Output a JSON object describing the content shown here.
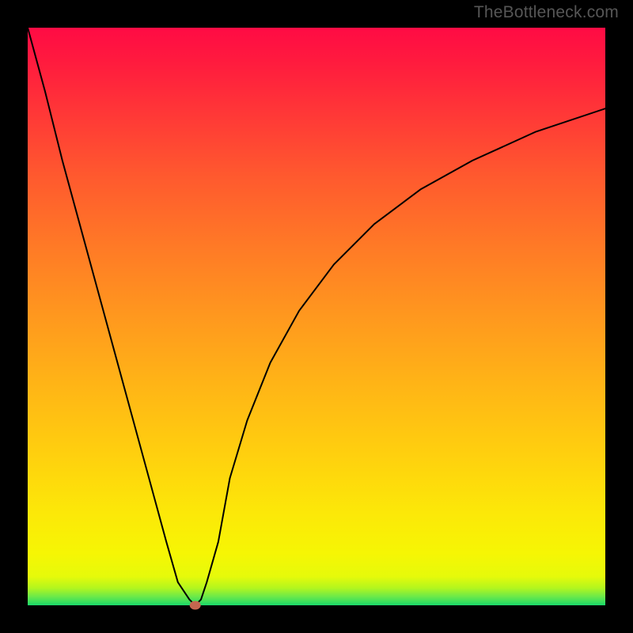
{
  "watermark": "TheBottleneck.com",
  "chart_data": {
    "type": "line",
    "title": "",
    "xlabel": "",
    "ylabel": "",
    "xlim": [
      0,
      100
    ],
    "ylim": [
      0,
      100
    ],
    "grid": false,
    "legend": false,
    "series": [
      {
        "name": "bottleneck-curve",
        "x": [
          0,
          3,
          6,
          9,
          12,
          15,
          18,
          21,
          24,
          26,
          28,
          29,
          30,
          31,
          33,
          35,
          38,
          42,
          47,
          53,
          60,
          68,
          77,
          88,
          100
        ],
        "y": [
          100,
          89,
          77,
          66,
          55,
          44,
          33,
          22,
          11,
          4,
          1,
          0,
          1,
          4,
          11,
          22,
          32,
          42,
          51,
          59,
          66,
          72,
          77,
          82,
          86
        ]
      }
    ],
    "marker": {
      "x": 29,
      "y": 0,
      "color": "#c4664f"
    }
  },
  "colors": {
    "gradient_top": "#ff0b44",
    "gradient_mid": "#ffb516",
    "gradient_bottom_green": "#19d96b",
    "curve": "#000000",
    "frame": "#000000"
  }
}
